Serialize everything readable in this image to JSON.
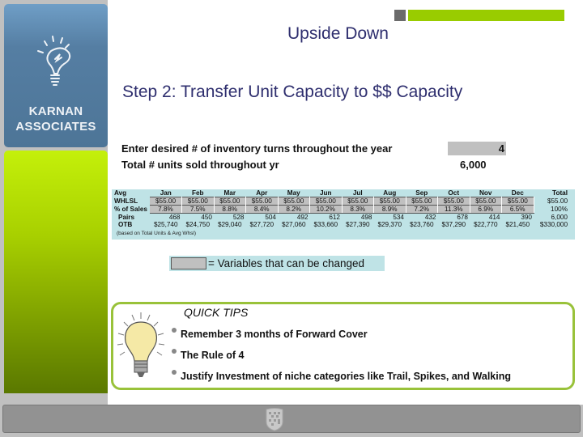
{
  "sidebar": {
    "brand_line1": "KARNAN",
    "brand_line2": "ASSOCIATES",
    "logo_icon": "lightbulb-icon"
  },
  "header": {
    "title": "Upside Down",
    "subtitle": "Step 2: Transfer Unit Capacity to $$ Capacity",
    "accent_color": "#99cc00"
  },
  "inputs": {
    "turns_label": "Enter desired # of inventory turns throughout the year",
    "turns_value": "4",
    "units_label": "Total # units sold throughout yr",
    "units_value": "6,000"
  },
  "table": {
    "header_label": "Avg",
    "columns": [
      "Jan",
      "Feb",
      "Mar",
      "Apr",
      "May",
      "Jun",
      "Jul",
      "Aug",
      "Sep",
      "Oct",
      "Nov",
      "Dec"
    ],
    "total_label": "Total",
    "rows": [
      {
        "label": "WHLSL",
        "values": [
          "$55.00",
          "$55.00",
          "$55.00",
          "$55.00",
          "$55.00",
          "$55.00",
          "$55.00",
          "$55.00",
          "$55.00",
          "$55.00",
          "$55.00",
          "$55.00"
        ],
        "total": "$55.00"
      },
      {
        "label": "% of Sales",
        "values": [
          "7.8%",
          "7.5%",
          "8.8%",
          "8.4%",
          "8.2%",
          "10.2%",
          "8.3%",
          "8.9%",
          "7.2%",
          "11.3%",
          "6.9%",
          "6.5%"
        ],
        "total": "100%"
      },
      {
        "label": "Pairs",
        "values": [
          "468",
          "450",
          "528",
          "504",
          "492",
          "612",
          "498",
          "534",
          "432",
          "678",
          "414",
          "390"
        ],
        "total": "6,000"
      },
      {
        "label": "OTB",
        "values": [
          "$25,740",
          "$24,750",
          "$29,040",
          "$27,720",
          "$27,060",
          "$33,660",
          "$27,390",
          "$29,370",
          "$23,760",
          "$37,290",
          "$22,770",
          "$21,450"
        ],
        "total": "$330,000"
      }
    ],
    "note": "(based on Total Units & Avg Whsl)"
  },
  "legend": {
    "text": "= Variables that can be changed"
  },
  "tips": {
    "title": "QUICK TIPS",
    "items": [
      "Remember 3 months of Forward Cover",
      "The Rule of 4",
      "Justify Investment of niche categories like Trail, Spikes, and Walking"
    ]
  },
  "footer": {
    "emblem_icon": "crest-icon"
  }
}
